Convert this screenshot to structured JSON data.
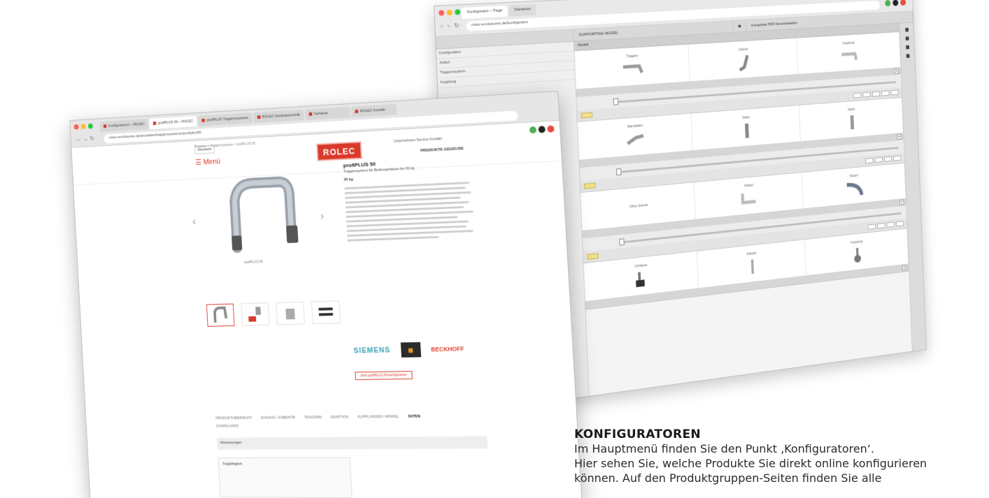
{
  "colors": {
    "brand_red": "#d9392a",
    "siemens_teal": "#3aa3b5",
    "text_dark": "#1a1a1a"
  },
  "configurator_window": {
    "tab_labels": [
      "Konfigurator – Page",
      "Startseite"
    ],
    "url": "rolec-enclosures.de/konfigurator",
    "toolbar": {
      "model_label": "SUPPORTING MODEL",
      "pdf_label": "Komplette PDF herunterladen"
    },
    "left_panel_rows": [
      "Konfiguration",
      "Artikel",
      "Tragarmsystem",
      "Kupplung"
    ],
    "section_header": "Modell",
    "groups": [
      {
        "cards": [
          "Tragarm",
          "Gelenk",
          "Kupplung"
        ]
      },
      {
        "cards": [
          "Wandhalter",
          "Säule",
          "Säule"
        ]
      },
      {
        "cards": [
          "Ohne Gelenk",
          "Winkel",
          "Bogen"
        ]
      },
      {
        "cards": [
          "Gehäuse",
          "Adapter",
          "Kupplung"
        ]
      }
    ]
  },
  "product_window": {
    "tabs": [
      "Konfiguratoren – ROLEC",
      "profiPLUS 50 – ROLEC",
      "profiPLUS Tragarmsysteme",
      "ROLEC Gehäusetechnik",
      "Gehäuse",
      "ROLEC Kontakt"
    ],
    "url": "rolec-enclosures.de/produkte/tragarmsysteme/profiplus50",
    "language": "Deutsch",
    "menu_label": "☰ Menü",
    "logo_text": "ROLEC",
    "top_nav": "Unternehmen  Service  Kontakt",
    "main_nav": "PRODUKTE   GEHÄUSE",
    "breadcrumb": "Produkte > Tragarmsysteme > profiPLUS 50",
    "image_caption": "profiPLUS 50",
    "product_title": "profiPLUS 50",
    "product_subtitle": "Tragarmsystem für Bediengehäuse bis 50 kg",
    "article_no": "50 kg",
    "partners": {
      "siemens": "SIEMENS",
      "wago": "WAGO",
      "beckhoff": "BECKHOFF"
    },
    "cta_label": "Jetzt profiPLUS 50 konfigurieren",
    "product_tabs": [
      "PRODUKTÜBERSICHT",
      "ZUGANG / ZUBEHÖR",
      "TRAGARM",
      "ADAPTION",
      "KUPPLUNGEN / WINKEL",
      "DATEN"
    ],
    "active_tab": "DATEN",
    "download_label": "DOWNLOADS",
    "panel_title": "Abmessungen",
    "panel2_title": "Tragfähigkeit"
  },
  "caption_block": {
    "heading": "KONFIGURATOREN",
    "line1": "Im Hauptmenü finden Sie den Punkt ‚Konfiguratoren‘.",
    "line2": "Hier sehen Sie, welche Produkte Sie direkt online konfigurieren",
    "line3": "können. Auf den Produktgruppen-Seiten finden Sie alle"
  }
}
